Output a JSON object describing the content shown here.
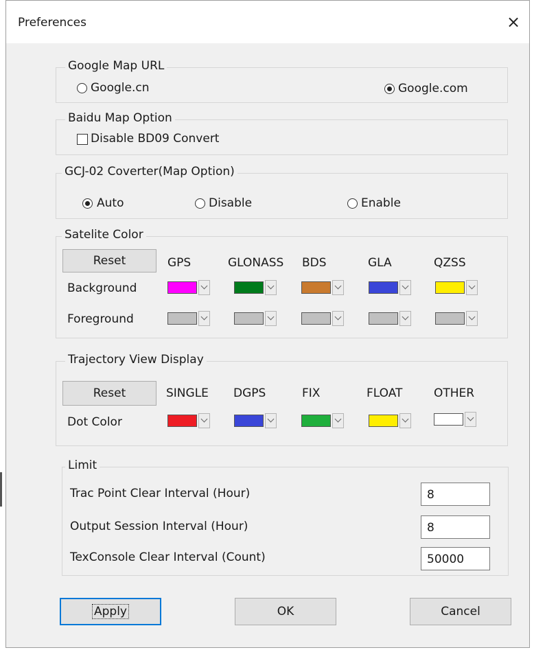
{
  "window": {
    "title": "Preferences",
    "close_glyph": "×"
  },
  "google_map": {
    "label": "Google Map URL",
    "options": [
      {
        "label": "Google.cn",
        "selected": false
      },
      {
        "label": "Google.com",
        "selected": true
      }
    ]
  },
  "baidu_map": {
    "label": "Baidu Map Option",
    "checkbox_label": "Disable BD09 Convert",
    "checked": false
  },
  "gcj": {
    "label": "GCJ-02 Coverter(Map Option)",
    "options": [
      {
        "label": "Auto",
        "selected": true
      },
      {
        "label": "Disable",
        "selected": false
      },
      {
        "label": "Enable",
        "selected": false
      }
    ]
  },
  "satellite": {
    "label": "Satelite Color",
    "reset_label": "Reset",
    "columns": [
      "GPS",
      "GLONASS",
      "BDS",
      "GLA",
      "QZSS"
    ],
    "rows": [
      {
        "label": "Background",
        "colors": [
          "#ff00ff",
          "#007b1c",
          "#c97a2e",
          "#3a46d8",
          "#ffee00"
        ]
      },
      {
        "label": "Foreground",
        "colors": [
          "#c0c0c0",
          "#c0c0c0",
          "#c0c0c0",
          "#c0c0c0",
          "#c0c0c0"
        ]
      }
    ]
  },
  "trajectory": {
    "label": "Trajectory View Display",
    "reset_label": "Reset",
    "columns": [
      "SINGLE",
      "DGPS",
      "FIX",
      "FLOAT",
      "OTHER"
    ],
    "row_label": "Dot Color",
    "colors": [
      "#ee1c24",
      "#3a46d8",
      "#1faf3c",
      "#ffee00",
      "#ffffff"
    ]
  },
  "limit": {
    "label": "Limit",
    "fields": [
      {
        "label": "Trac Point Clear Interval (Hour)",
        "value": "8"
      },
      {
        "label": "Output Session Interval (Hour)",
        "value": "8"
      },
      {
        "label": "TexConsole Clear Interval (Count)",
        "value": "50000"
      }
    ]
  },
  "buttons": {
    "apply": "Apply",
    "ok": "OK",
    "cancel": "Cancel"
  }
}
